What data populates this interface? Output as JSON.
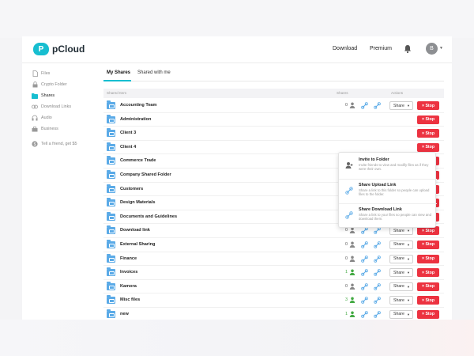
{
  "header": {
    "brand": "pCloud",
    "brand_mark": "P",
    "nav_download": "Download",
    "nav_premium": "Premium",
    "avatar_initial": "B"
  },
  "sidebar": {
    "items": [
      {
        "label": "Files",
        "icon": "file-icon"
      },
      {
        "label": "Crypto Folder",
        "icon": "lock-icon"
      },
      {
        "label": "Shares",
        "icon": "share-folder-icon",
        "active": true
      },
      {
        "label": "Download Links",
        "icon": "link-icon"
      },
      {
        "label": "Audio",
        "icon": "headphones-icon"
      },
      {
        "label": "Business",
        "icon": "briefcase-icon"
      }
    ],
    "referral": "Tell a friend, get $5"
  },
  "tabs": [
    "My Shares",
    "Shared with me"
  ],
  "table": {
    "col_item": "Shared Item",
    "col_shares": "Shares",
    "col_actions": "Actions",
    "share_label": "Share",
    "stop_label": "× Stop",
    "rows": [
      {
        "name": "Accounting Team",
        "count": "0"
      },
      {
        "name": "Administration",
        "count": ""
      },
      {
        "name": "Client 3",
        "count": ""
      },
      {
        "name": "Client 4",
        "count": ""
      },
      {
        "name": "Commerce Trade",
        "count": ""
      },
      {
        "name": "Company Shared Folder",
        "count": ""
      },
      {
        "name": "Customers",
        "count": ""
      },
      {
        "name": "Design Materials",
        "count": "0"
      },
      {
        "name": "Documents and Guidelines",
        "count": "1"
      },
      {
        "name": "Download link",
        "count": "0"
      },
      {
        "name": "External Sharing",
        "count": "0"
      },
      {
        "name": "Finance",
        "count": "0"
      },
      {
        "name": "Invoices",
        "count": "1"
      },
      {
        "name": "Kamora",
        "count": "0"
      },
      {
        "name": "Misc files",
        "count": "3"
      },
      {
        "name": "new",
        "count": "1"
      }
    ]
  },
  "dropdown": {
    "items": [
      {
        "title": "Invite to Folder",
        "desc": "Invite friends to view and modify files as if they were their own."
      },
      {
        "title": "Share Upload Link",
        "desc": "Share a link to this folder so people can upload files to the folder."
      },
      {
        "title": "Share Download Link",
        "desc": "Share a link to your files so people can view and download them."
      }
    ]
  },
  "colors": {
    "accent": "#17bed0",
    "stop": "#ec3240",
    "folder": "#5aaae7",
    "shared_green": "#4a4"
  }
}
